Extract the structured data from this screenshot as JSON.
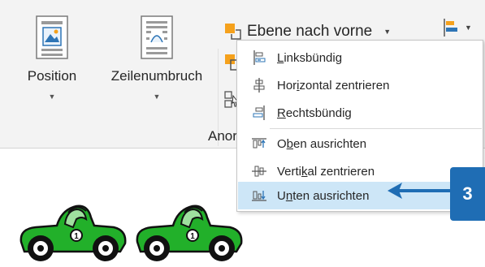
{
  "ribbon": {
    "position_label": "Position",
    "wrap_label": "Zeilenumbruch",
    "bring_forward_label": "Ebene nach vorne",
    "group_label": "Anor"
  },
  "menu": {
    "items": [
      {
        "label_u": "L",
        "label_rest": "inksbündig",
        "icon": "align-left-icon"
      },
      {
        "label_pre": "Hor",
        "label_u": "i",
        "label_rest": "zontal zentrieren",
        "icon": "align-center-horizontal-icon"
      },
      {
        "label_u": "R",
        "label_rest": "echtsbündig",
        "icon": "align-right-icon"
      },
      {
        "label_pre": "O",
        "label_u": "b",
        "label_rest": "en ausrichten",
        "icon": "align-top-icon"
      },
      {
        "label_pre": "Verti",
        "label_u": "k",
        "label_rest": "al zentrieren",
        "icon": "align-middle-vertical-icon"
      },
      {
        "label_pre": "U",
        "label_u": "n",
        "label_rest": "ten ausrichten",
        "icon": "align-bottom-icon",
        "highlighted": true
      }
    ]
  },
  "callout": {
    "number": "3",
    "color": "#1f6db4"
  },
  "colors": {
    "ribbon_bg": "#f3f3f3",
    "highlight": "#cde6f7",
    "car_green": "#22b02a",
    "accent_orange": "#f5a11c"
  }
}
